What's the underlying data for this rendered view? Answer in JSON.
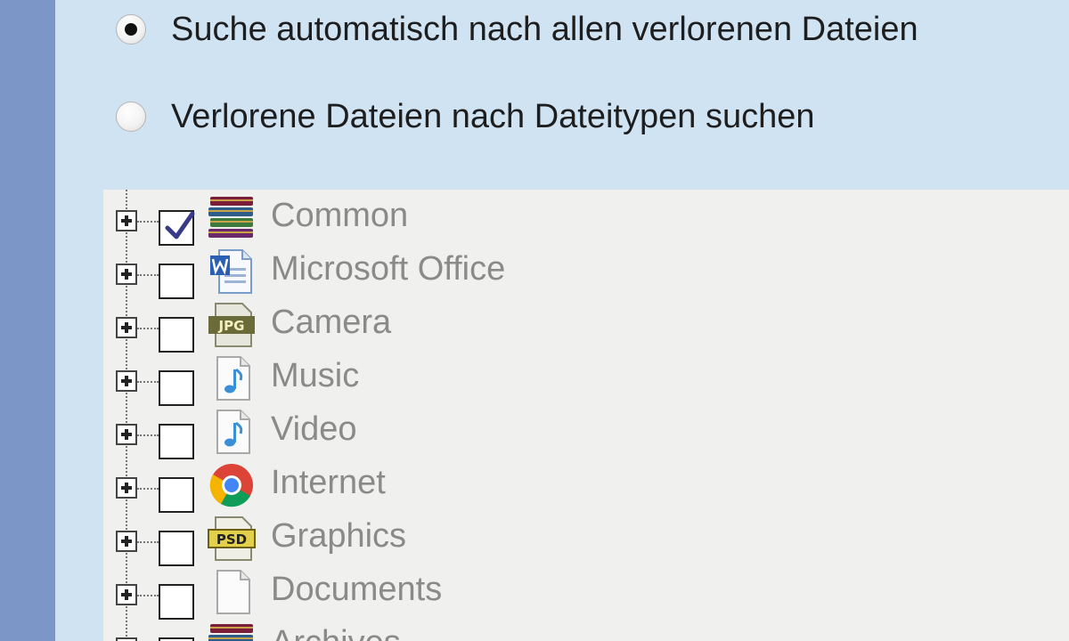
{
  "options": {
    "auto": {
      "label": "Suche automatisch nach allen verlorenen Dateien",
      "selected": true
    },
    "by_type": {
      "label": "Verlorene Dateien nach Dateitypen suchen",
      "selected": false
    }
  },
  "tree": {
    "items": [
      {
        "label": "Common",
        "checked": true,
        "icon": "books-stack-icon"
      },
      {
        "label": "Microsoft Office",
        "checked": false,
        "icon": "word-document-icon"
      },
      {
        "label": "Camera",
        "checked": false,
        "icon": "jpg-file-icon"
      },
      {
        "label": "Music",
        "checked": false,
        "icon": "music-note-file-icon"
      },
      {
        "label": "Video",
        "checked": false,
        "icon": "music-note-file-icon"
      },
      {
        "label": "Internet",
        "checked": false,
        "icon": "chrome-icon"
      },
      {
        "label": "Graphics",
        "checked": false,
        "icon": "psd-file-icon"
      },
      {
        "label": "Documents",
        "checked": false,
        "icon": "blank-document-icon"
      },
      {
        "label": "Archives",
        "checked": false,
        "icon": "books-stack-icon"
      }
    ]
  },
  "icon_text": {
    "jpg": "JPG",
    "psd": "PSD"
  },
  "colors": {
    "panel_bg": "#cfe3f3",
    "left_strip": "#7d96c8",
    "tree_bg": "#f0f0ee",
    "label_gray": "#8a8a8a",
    "check_mark": "#3a3a8a"
  }
}
